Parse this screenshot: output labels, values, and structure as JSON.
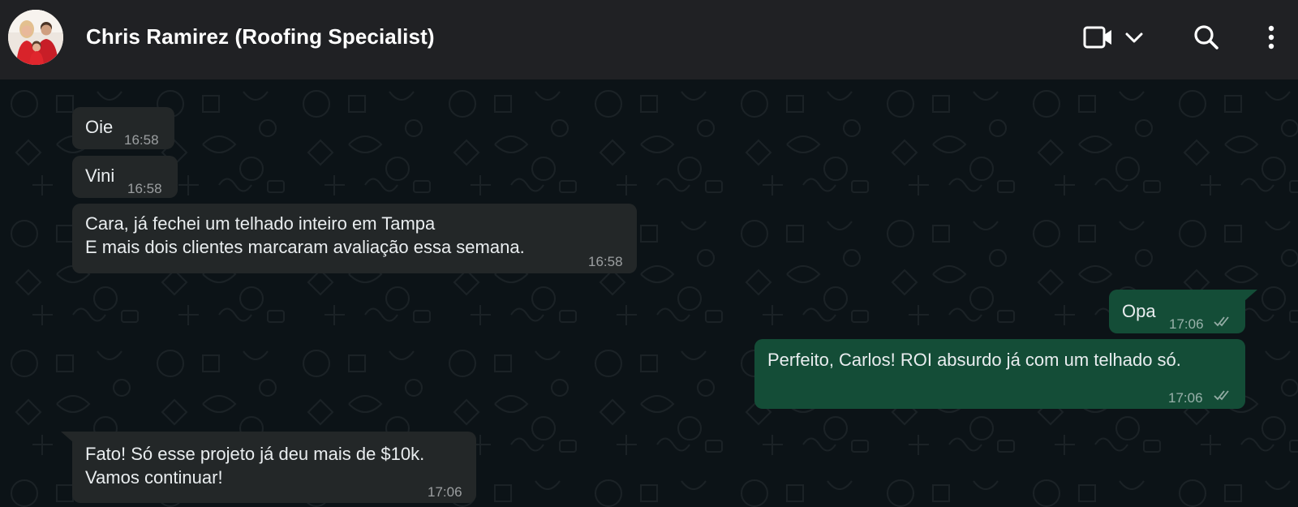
{
  "header": {
    "contact_name": "Chris Ramirez (Roofing Specialist)",
    "icons": [
      "avatar",
      "video-call-icon",
      "chevron-down-icon",
      "search-icon",
      "more-options-icon"
    ]
  },
  "messages": [
    {
      "direction": "in",
      "text": "Oie",
      "time": "16:58"
    },
    {
      "direction": "in",
      "text": "Vini",
      "time": "16:58"
    },
    {
      "direction": "in",
      "lines": [
        "Cara, já fechei um telhado inteiro em Tampa",
        "E mais dois clientes marcaram avaliação essa semana."
      ],
      "time": "16:58"
    },
    {
      "direction": "out",
      "text": "Opa",
      "time": "17:06",
      "status": "read"
    },
    {
      "direction": "out",
      "text": "Perfeito, Carlos! ROI absurdo já com um telhado só.",
      "time": "17:06",
      "status": "read"
    },
    {
      "direction": "in",
      "lines": [
        "Fato! Só esse projeto já deu mais de $10k.",
        "Vamos continuar!"
      ],
      "time": "17:06"
    }
  ],
  "colors": {
    "header_bg": "#202124",
    "chat_bg": "#0c1317",
    "incoming_bubble": "#232728",
    "outgoing_bubble": "#144d37",
    "text": "#e9edef"
  }
}
